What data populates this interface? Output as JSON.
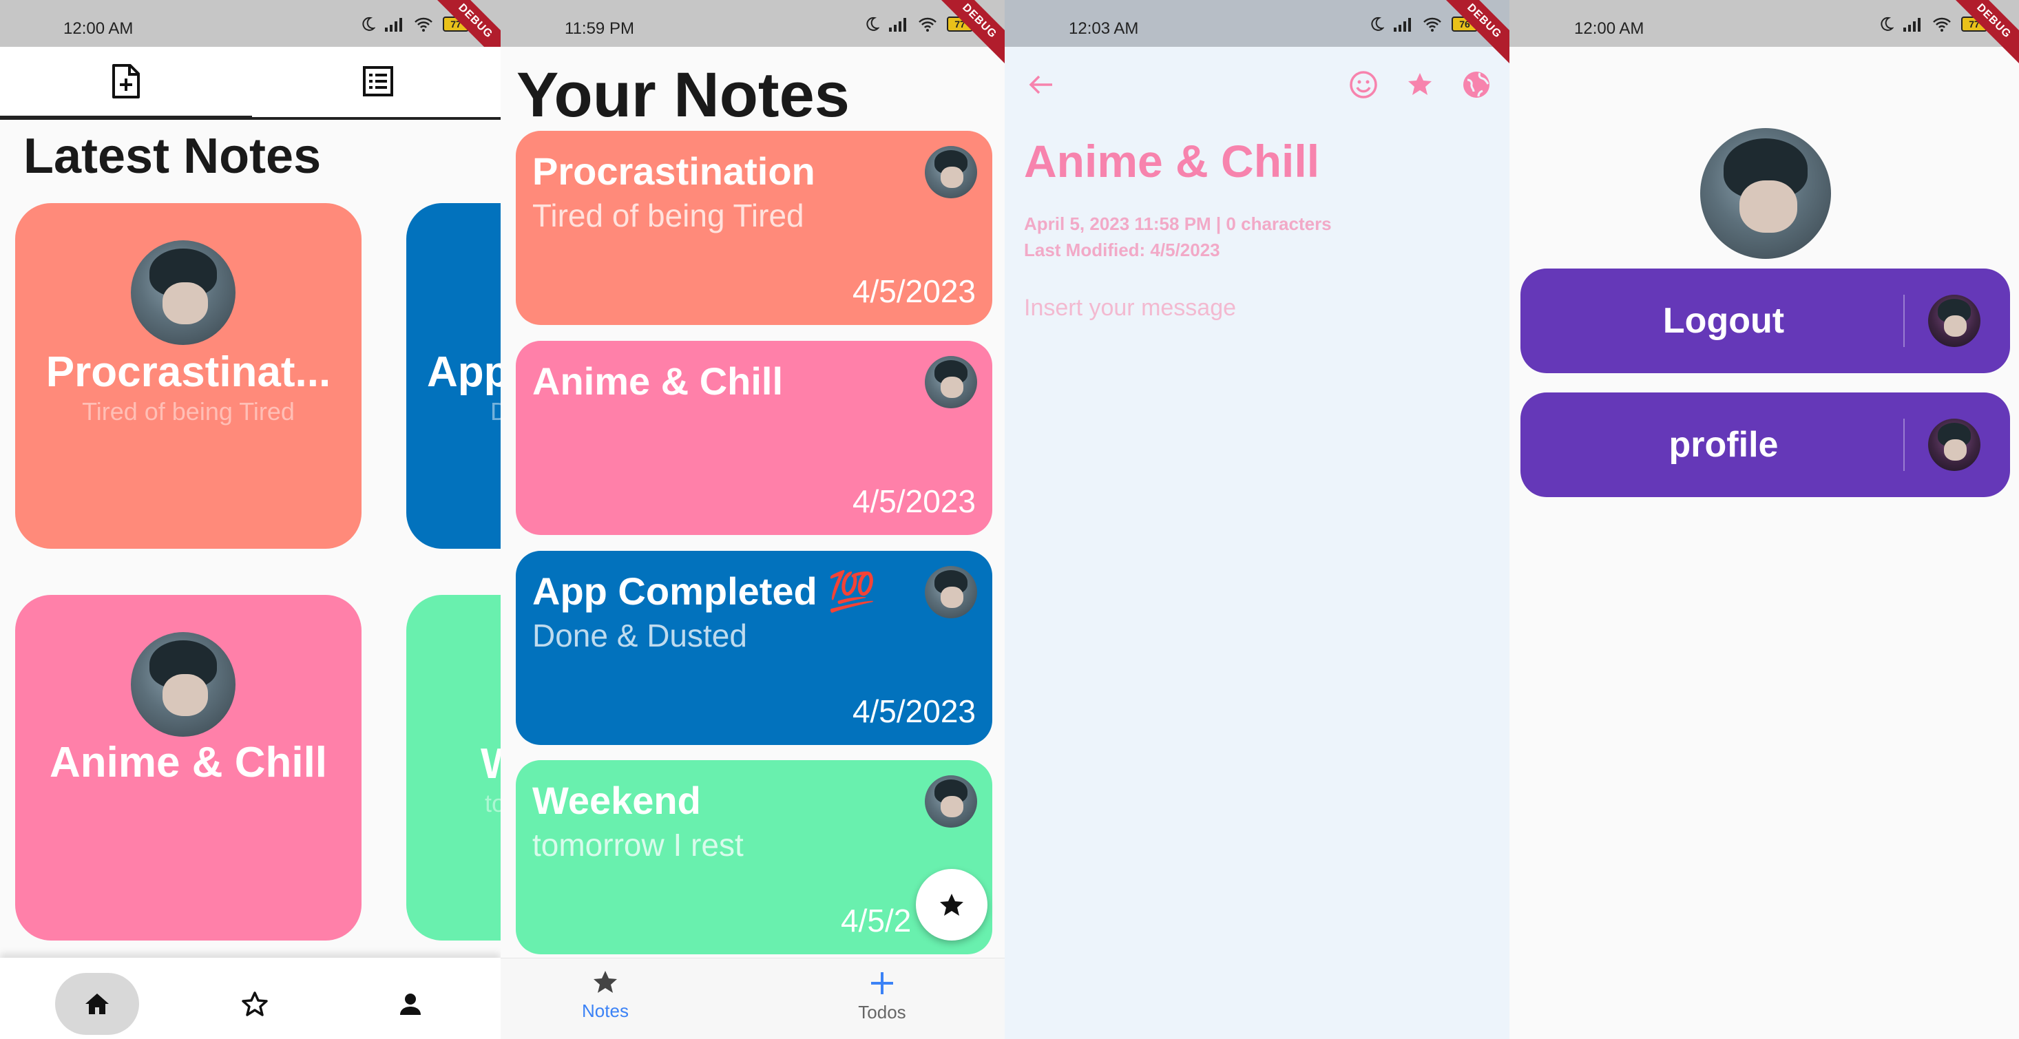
{
  "panel1": {
    "status_time": "12:00 AM",
    "battery": "77",
    "debug": "DEBUG",
    "title": "Latest Notes",
    "tabs": [
      "new-note-icon",
      "list-icon"
    ],
    "cards": [
      {
        "title": "Procrastinat...",
        "subtitle": "Tired of being Tired",
        "color": "#ff8a7a"
      },
      {
        "title": "App",
        "subtitle": "D",
        "color": "#0272bd"
      },
      {
        "title": "Anime & Chill",
        "subtitle": "",
        "color": "#ff80a9"
      },
      {
        "title": "W",
        "subtitle": "to",
        "color": "#69f0ae"
      }
    ],
    "nav": [
      "home-icon",
      "star-outline-icon",
      "person-icon"
    ]
  },
  "panel2": {
    "status_time": "11:59 PM",
    "battery": "77",
    "debug": "DEBUG",
    "title": "Your Notes",
    "notes": [
      {
        "title": "Procrastination",
        "subtitle": "Tired of being Tired",
        "date": "4/5/2023",
        "color": "#ff8a7a"
      },
      {
        "title": "Anime & Chill",
        "subtitle": "",
        "date": "4/5/2023",
        "color": "#ff80a9"
      },
      {
        "title": "App Completed 💯",
        "subtitle": "Done & Dusted",
        "date": "4/5/2023",
        "color": "#0272bd"
      },
      {
        "title": "Weekend",
        "subtitle": "tomorrow I rest",
        "date": "4/5/2",
        "color": "#69f0ae"
      }
    ],
    "nav": {
      "notes_label": "Notes",
      "todos_label": "Todos"
    },
    "accent": "#3b82f6"
  },
  "panel3": {
    "status_time": "12:03 AM",
    "battery": "76",
    "debug": "DEBUG",
    "title": "Anime & Chill",
    "meta_line1": "April 5, 2023 11:58 PM | 0 characters",
    "meta_line2": "Last Modified: 4/5/2023",
    "input_placeholder": "Insert your message",
    "accent": "#f783ad"
  },
  "panel4": {
    "status_time": "12:00 AM",
    "battery": "77",
    "debug": "DEBUG",
    "buttons": [
      {
        "label": "Logout"
      },
      {
        "label": "profile"
      }
    ],
    "button_color": "#6538b8"
  }
}
